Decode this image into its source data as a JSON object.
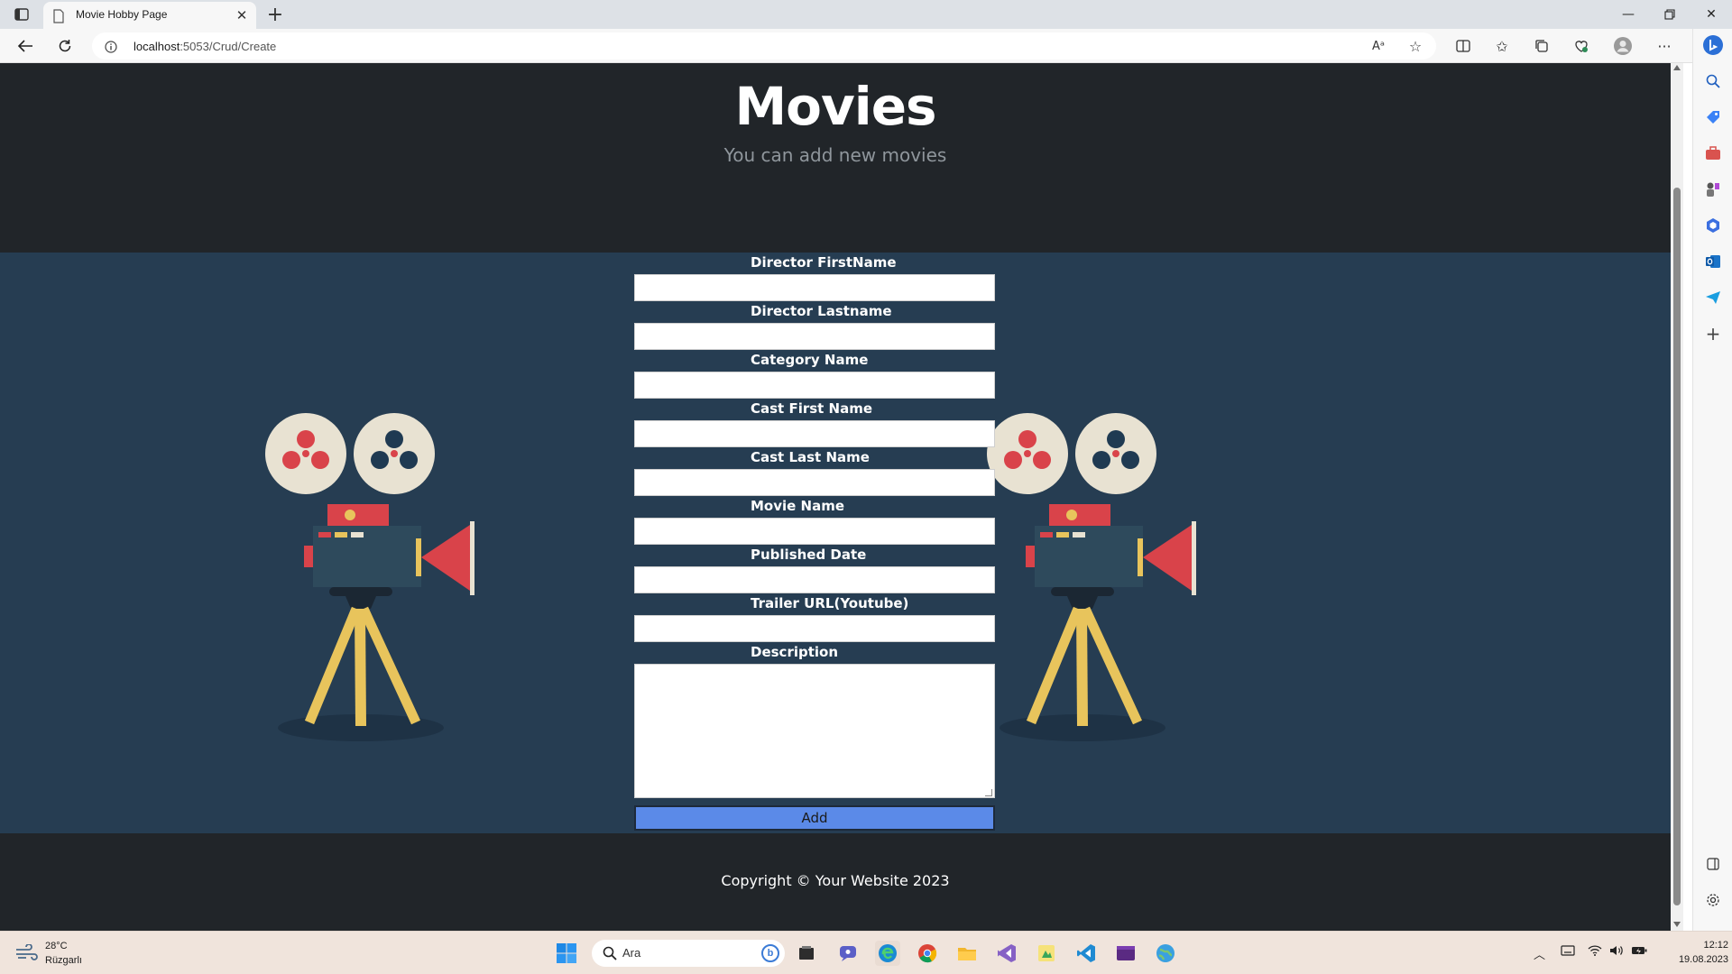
{
  "browser": {
    "tab_title": "Movie Hobby Page",
    "url_host": "localhost",
    "url_rest": ":5053/Crud/Create"
  },
  "hero": {
    "title": "Movies",
    "subtitle": "You can add new movies"
  },
  "form": {
    "fields": [
      {
        "label": "Director FirstName",
        "value": ""
      },
      {
        "label": "Director Lastname",
        "value": ""
      },
      {
        "label": "Category Name",
        "value": ""
      },
      {
        "label": "Cast First Name",
        "value": ""
      },
      {
        "label": "Cast Last Name",
        "value": ""
      },
      {
        "label": "Movie Name",
        "value": ""
      },
      {
        "label": "Published Date",
        "value": ""
      },
      {
        "label": "Trailer URL(Youtube)",
        "value": ""
      }
    ],
    "description_label": "Description",
    "description_value": "",
    "submit_label": "Add"
  },
  "footer": {
    "copyright": "Copyright © Your Website 2023"
  },
  "taskbar": {
    "weather_temp": "28°C",
    "weather_condition": "Rüzgarlı",
    "search_placeholder": "Ara",
    "clock_time": "12:12",
    "clock_date": "19.08.2023"
  },
  "colors": {
    "hero_bg": "#212529",
    "content_bg": "#263d52",
    "button_bg": "#5b8ae8"
  }
}
